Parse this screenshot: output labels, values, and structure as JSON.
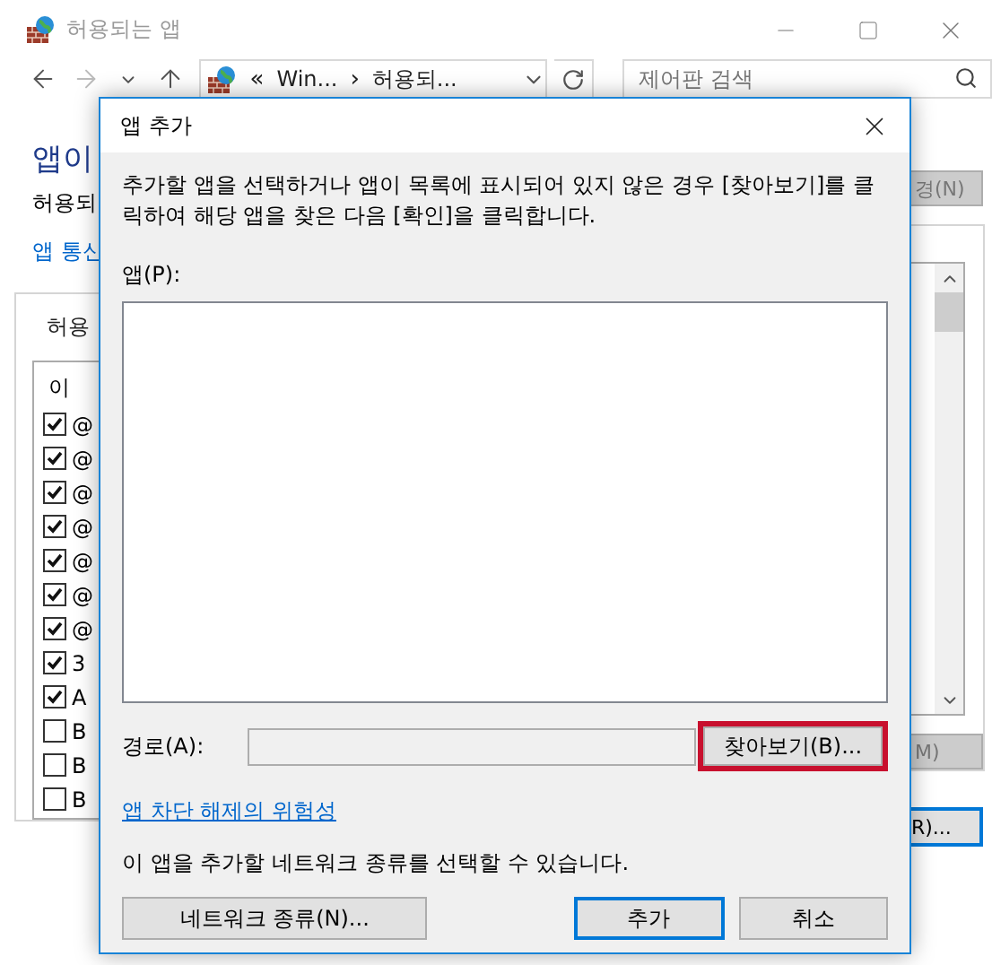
{
  "window": {
    "title": "허용되는 앱"
  },
  "address_bar": {
    "segments": [
      {
        "kind": "separator",
        "text": "«"
      },
      {
        "kind": "crumb",
        "text": "Win..."
      },
      {
        "kind": "separator",
        "text": "›"
      },
      {
        "kind": "crumb",
        "text": "허용되..."
      }
    ]
  },
  "search": {
    "placeholder": "제어판 검색"
  },
  "page": {
    "heading": "앱이",
    "subtitle": "허용되",
    "link": "앱 통신",
    "change_button": {
      "label": "경(N)",
      "disabled": true
    },
    "group": {
      "label": "허용",
      "column_header": "이",
      "rows": [
        {
          "label": "@",
          "checked": true
        },
        {
          "label": "@",
          "checked": true
        },
        {
          "label": "@",
          "checked": true
        },
        {
          "label": "@",
          "checked": true
        },
        {
          "label": "@",
          "checked": true
        },
        {
          "label": "@",
          "checked": true
        },
        {
          "label": "@",
          "checked": true
        },
        {
          "label": "3",
          "checked": true
        },
        {
          "label": "A",
          "checked": true
        },
        {
          "label": "B",
          "checked": false
        },
        {
          "label": "B",
          "checked": false
        },
        {
          "label": "B",
          "checked": false
        }
      ]
    },
    "remove_button": {
      "label": "M)",
      "disabled": true
    },
    "allow_button": {
      "label": "R)...",
      "disabled": false
    }
  },
  "dialog": {
    "title": "앱 추가",
    "description": "추가할 앱을 선택하거나 앱이 목록에 표시되어 있지 않은 경우 [찾아보기]를 클릭하여 해당 앱을 찾은 다음 [확인]을 클릭합니다.",
    "apps_label": "앱(P):",
    "path_label": "경로(A):",
    "browse_button": {
      "label": "찾아보기(B)...",
      "highlighted": true
    },
    "risk_link": "앱 차단 해제의 위험성",
    "network_note": "이 앱을 추가할 네트워크 종류를 선택할 수 있습니다.",
    "network_button": "네트워크 종류(N)...",
    "add_button": "추가",
    "cancel_button": "취소"
  }
}
